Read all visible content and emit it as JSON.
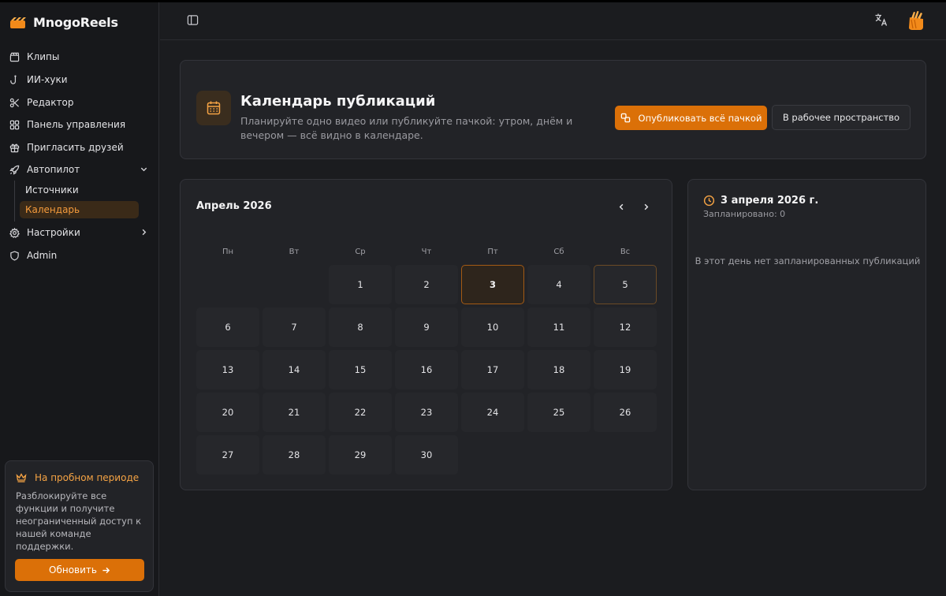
{
  "app": {
    "name": "MnogoReels"
  },
  "sidebar": {
    "items": [
      {
        "label": "Клипы",
        "icon": "clapperboard-icon"
      },
      {
        "label": "ИИ-хуки",
        "icon": "hook-icon"
      },
      {
        "label": "Редактор",
        "icon": "scissors-icon"
      },
      {
        "label": "Панель управления",
        "icon": "dashboard-icon"
      },
      {
        "label": "Пригласить друзей",
        "icon": "gift-icon"
      },
      {
        "label": "Автопилот",
        "icon": "rocket-icon"
      },
      {
        "label": "Настройки",
        "icon": "gear-icon"
      },
      {
        "label": "Admin",
        "icon": "shield-icon"
      }
    ],
    "autopilot_sub": [
      {
        "label": "Источники"
      },
      {
        "label": "Календарь"
      }
    ],
    "trial": {
      "title": "На пробном периоде",
      "text": "Разблокируйте все функции и получите неограниченный доступ к нашей команде поддержки.",
      "button": "Обновить"
    }
  },
  "header": {
    "title": "Календарь публикаций",
    "subtitle": "Планируйте одно видео или публикуйте пачкой: утром, днём и вечером — всё видно в календаре.",
    "publish_button": "Опубликовать всё пачкой",
    "workspace_button": "В рабочее пространство"
  },
  "calendar": {
    "month": "Апрель 2026",
    "weekdays": [
      "Пн",
      "Вт",
      "Ср",
      "Чт",
      "Пт",
      "Сб",
      "Вс"
    ],
    "first_weekday_index": 2,
    "days_in_month": 30,
    "selected_day": 3,
    "today_day": 5
  },
  "detail": {
    "date": "3 апреля 2026 г.",
    "scheduled": "Запланировано: 0",
    "empty": "В этот день нет запланированных публикаций"
  },
  "colors": {
    "accent": "#db7008",
    "accent_text": "#f59b3c"
  }
}
